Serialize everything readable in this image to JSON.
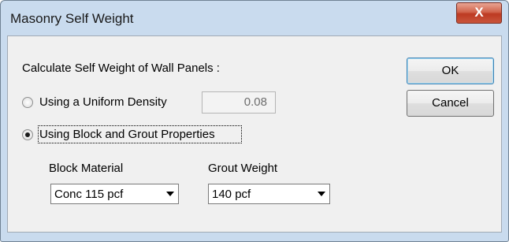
{
  "window": {
    "title": "Masonry Self Weight",
    "close_glyph": "X"
  },
  "dialog": {
    "heading": "Calculate Self Weight of Wall Panels :",
    "options": {
      "uniform_density_label": "Using a Uniform Density",
      "uniform_density_value": "0.08",
      "uniform_density_selected": false,
      "block_grout_label": "Using Block and Grout Properties",
      "block_grout_selected": true
    },
    "block_material": {
      "label": "Block Material",
      "value": "Conc 115 pcf"
    },
    "grout_weight": {
      "label": "Grout Weight",
      "value": "140 pcf"
    }
  },
  "buttons": {
    "ok_label": "OK",
    "cancel_label": "Cancel"
  },
  "colors": {
    "frame": "#c9dbee",
    "close_button": "#c9553c",
    "client": "#f0f0f0"
  }
}
